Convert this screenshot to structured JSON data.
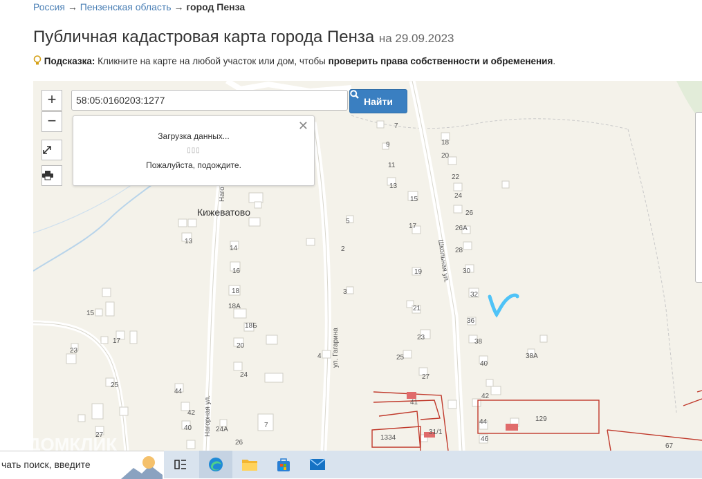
{
  "breadcrumb": {
    "items": [
      "Россия",
      "Пензенская область",
      "город Пенза"
    ],
    "sep": "→"
  },
  "title": {
    "main": "Публичная кадастровая карта города Пенза",
    "date": "на 29.09.2023"
  },
  "hint": {
    "label": "Подсказка:",
    "text": "Кликните на карте на любой участок или дом, чтобы",
    "bold": "проверить права собственности и обременения",
    "end": "."
  },
  "search": {
    "value": "58:05:0160203:1277",
    "button": "Найти"
  },
  "controls": {
    "zoom_in": "+",
    "zoom_out": "−"
  },
  "loading": {
    "line1": "Загрузка данных...",
    "dots": "▯▯▯",
    "line2": "Пожалуйста, подождите.",
    "close": "✕"
  },
  "map": {
    "village": "Кижеватово",
    "streets": [
      "Нагорная ул.",
      "ул. Гагарина",
      "Школьная ул.",
      "Наго"
    ],
    "house_numbers": [
      "7",
      "9",
      "11",
      "13",
      "18",
      "20",
      "22",
      "24",
      "26",
      "26А",
      "28",
      "30",
      "32",
      "36",
      "38",
      "38А",
      "40",
      "42",
      "44",
      "46",
      "15",
      "17",
      "19",
      "21",
      "23",
      "25",
      "27",
      "5",
      "2",
      "3",
      "4",
      "14",
      "16",
      "18",
      "18А",
      "18Б",
      "20",
      "24",
      "26",
      "24А",
      "13",
      "15",
      "17",
      "23",
      "25",
      "27",
      "7",
      "42",
      "44",
      "40",
      "41",
      "31/1",
      "1334",
      "129",
      "67"
    ],
    "colors": {
      "background": "#f4f2ea",
      "building": "#ffffff",
      "parcel": "#c0392b",
      "road": "#ffffff",
      "mark": "#4fc3f7"
    }
  },
  "watermark": "ДОМКЛИК",
  "taskbar": {
    "search_placeholder": "чать поиск, введите"
  }
}
